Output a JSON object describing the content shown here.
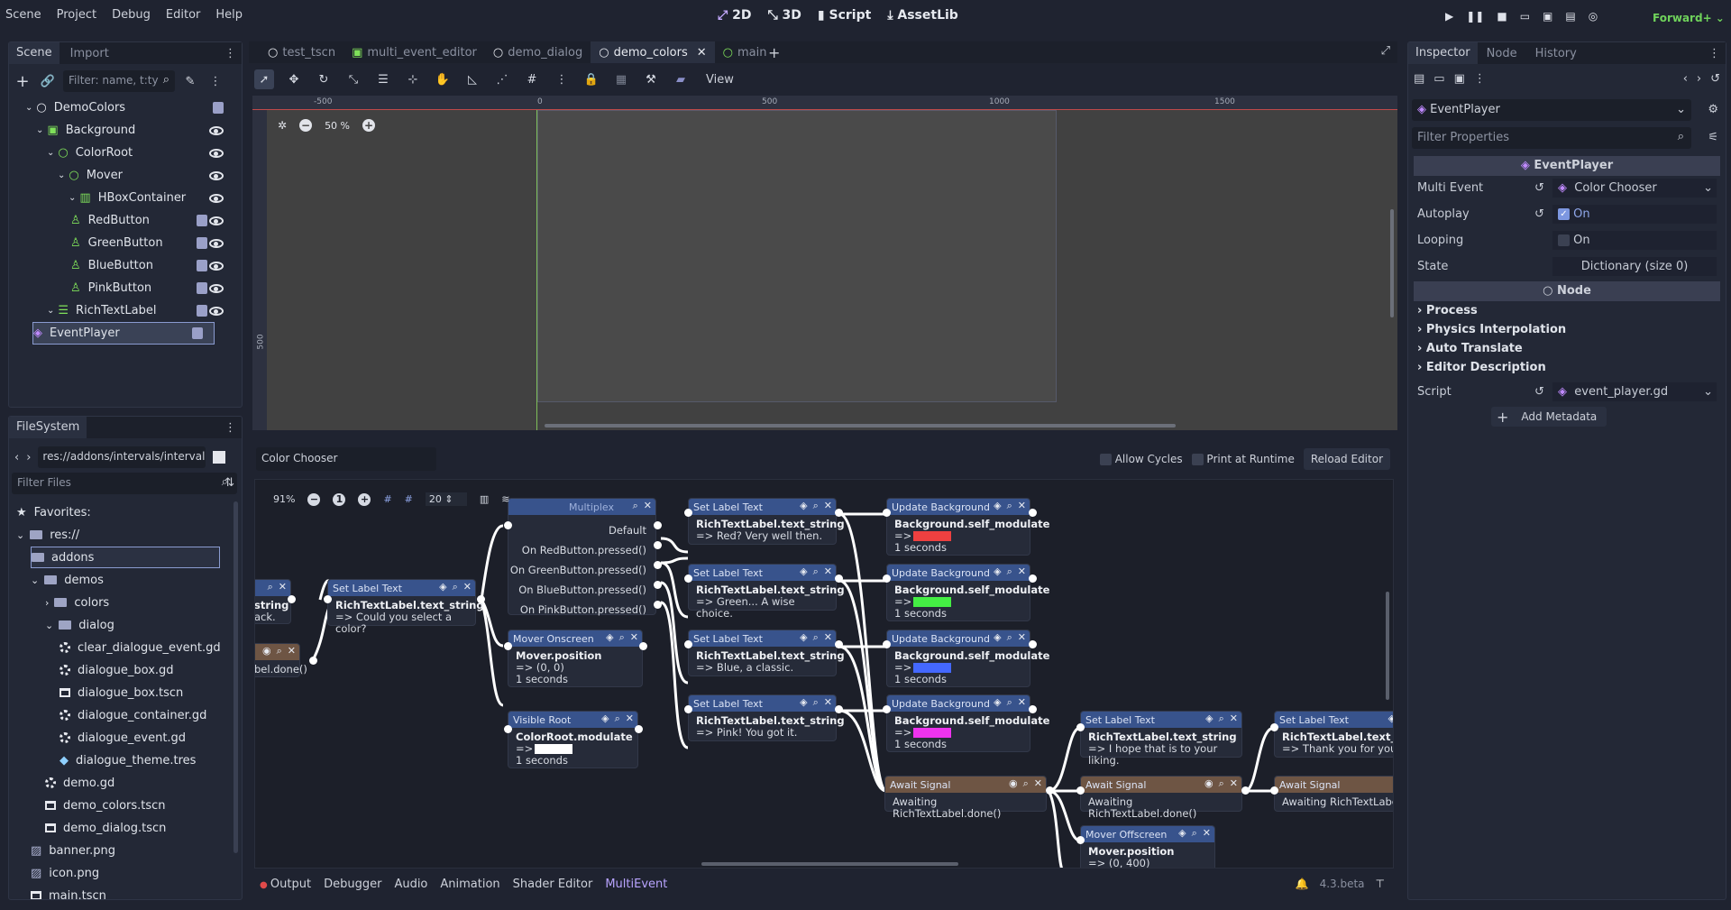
{
  "menu": [
    "Scene",
    "Project",
    "Debug",
    "Editor",
    "Help"
  ],
  "workspaces": [
    {
      "icon": "2d-icon",
      "label": "2D"
    },
    {
      "icon": "3d-icon",
      "label": "3D"
    },
    {
      "icon": "script-icon",
      "label": "Script"
    },
    {
      "icon": "assetlib-icon",
      "label": "AssetLib"
    }
  ],
  "renderer": "Forward+",
  "scene_panel": {
    "tabs": [
      "Scene",
      "Import"
    ],
    "filter_placeholder": "Filter: name, t:ty",
    "tree": [
      {
        "label": "DemoColors",
        "indent": 0
      },
      {
        "label": "Background",
        "indent": 1
      },
      {
        "label": "ColorRoot",
        "indent": 2
      },
      {
        "label": "Mover",
        "indent": 3
      },
      {
        "label": "HBoxContainer",
        "indent": 4
      },
      {
        "label": "RedButton",
        "indent": 5
      },
      {
        "label": "GreenButton",
        "indent": 5
      },
      {
        "label": "BlueButton",
        "indent": 5
      },
      {
        "label": "PinkButton",
        "indent": 5
      },
      {
        "label": "RichTextLabel",
        "indent": 2
      },
      {
        "label": "EventPlayer",
        "indent": 1
      }
    ]
  },
  "filesystem": {
    "tab": "FileSystem",
    "path": "res://addons/intervals/interval",
    "filter_placeholder": "Filter Files",
    "items": [
      {
        "label": "Favorites:",
        "indent": 0,
        "kind": "star"
      },
      {
        "label": "res://",
        "indent": 0,
        "kind": "folder"
      },
      {
        "label": "addons",
        "indent": 1,
        "kind": "folder"
      },
      {
        "label": "demos",
        "indent": 1,
        "kind": "folder"
      },
      {
        "label": "colors",
        "indent": 2,
        "kind": "folder"
      },
      {
        "label": "dialog",
        "indent": 2,
        "kind": "folder"
      },
      {
        "label": "clear_dialogue_event.gd",
        "indent": 3,
        "kind": "gear"
      },
      {
        "label": "dialogue_box.gd",
        "indent": 3,
        "kind": "gear"
      },
      {
        "label": "dialogue_box.tscn",
        "indent": 3,
        "kind": "clap"
      },
      {
        "label": "dialogue_container.gd",
        "indent": 3,
        "kind": "gear"
      },
      {
        "label": "dialogue_event.gd",
        "indent": 3,
        "kind": "gear"
      },
      {
        "label": "dialogue_theme.tres",
        "indent": 3,
        "kind": "theme"
      },
      {
        "label": "demo.gd",
        "indent": 2,
        "kind": "gear"
      },
      {
        "label": "demo_colors.tscn",
        "indent": 2,
        "kind": "clap"
      },
      {
        "label": "demo_dialog.tscn",
        "indent": 2,
        "kind": "clap"
      },
      {
        "label": "banner.png",
        "indent": 1,
        "kind": "img"
      },
      {
        "label": "icon.png",
        "indent": 1,
        "kind": "img"
      },
      {
        "label": "main.tscn",
        "indent": 1,
        "kind": "clap"
      }
    ]
  },
  "editor_tabs": [
    "test_tscn",
    "multi_event_editor",
    "demo_dialog",
    "demo_colors",
    "main"
  ],
  "toolbar": {
    "view_label": "View"
  },
  "viewport": {
    "zoom": "50 %",
    "ruler_labels": [
      "-500",
      "0",
      "500",
      "1000",
      "1500"
    ],
    "vruler_label": "500"
  },
  "multievent": {
    "name": "Color Chooser",
    "allow_cycles": "Allow Cycles",
    "print_runtime": "Print at Runtime",
    "reload": "Reload Editor",
    "zoom": "91%",
    "snap": "20"
  },
  "nodes": {
    "multiplex": {
      "title": "Multiplex",
      "rows": [
        "Default",
        "On RedButton.pressed()",
        "On GreenButton.pressed()",
        "On BlueButton.pressed()",
        "On PinkButton.pressed()"
      ]
    },
    "set_label_main": {
      "title": "Set Label Text",
      "prop": "RichTextLabel.text_string",
      "val": "=> Could you select a color?"
    },
    "left_node": {
      "prop": "string",
      "val": "ack."
    },
    "left_await": {
      "val": "bel.done()"
    },
    "mover_on": {
      "title": "Mover Onscreen",
      "prop": "Mover.position",
      "val": "=> (0, 0)",
      "dur": "1 seconds"
    },
    "visible_root": {
      "title": "Visible Root",
      "prop": "ColorRoot.modulate",
      "val": "=>",
      "dur": "1 seconds"
    },
    "labels": [
      {
        "title": "Set Label Text",
        "prop": "RichTextLabel.text_string",
        "val": "=> Red? Very well then."
      },
      {
        "title": "Set Label Text",
        "prop": "RichTextLabel.text_string",
        "val": "=> Green... A wise choice."
      },
      {
        "title": "Set Label Text",
        "prop": "RichTextLabel.text_string",
        "val": "=> Blue, a classic."
      },
      {
        "title": "Set Label Text",
        "prop": "RichTextLabel.text_string",
        "val": "=> Pink! You got it."
      }
    ],
    "backgrounds": [
      {
        "title": "Update Background",
        "prop": "Background.self_modulate",
        "val": "=>",
        "dur": "1 seconds",
        "color": "#ee4040"
      },
      {
        "title": "Update Background",
        "prop": "Background.self_modulate",
        "val": "=>",
        "dur": "1 seconds",
        "color": "#44ee44"
      },
      {
        "title": "Update Background",
        "prop": "Background.self_modulate",
        "val": "=>",
        "dur": "1 seconds",
        "color": "#4468ff"
      },
      {
        "title": "Update Background",
        "prop": "Background.self_modulate",
        "val": "=>",
        "dur": "1 seconds",
        "color": "#ee33ee"
      }
    ],
    "await1": {
      "title": "Await Signal",
      "val": "Awaiting RichTextLabel.done()"
    },
    "await2": {
      "title": "Await Signal",
      "val": "Awaiting RichTextLabel.done()"
    },
    "await3": {
      "title": "Await Signal",
      "val": "Awaiting RichTextLabe"
    },
    "label_hope": {
      "title": "Set Label Text",
      "prop": "RichTextLabel.text_string",
      "val": "=> I hope that is to your liking."
    },
    "label_thank": {
      "title": "Set Label Text",
      "prop": "RichTextLabel.text_st",
      "val": "=> Thank you for your"
    },
    "mover_off": {
      "title": "Mover Offscreen",
      "prop": "Mover.position",
      "val": "=> (0, 400)"
    }
  },
  "bottom_tabs": [
    "Output",
    "Debugger",
    "Audio",
    "Animation",
    "Shader Editor",
    "MultiEvent"
  ],
  "version": "4.3.beta",
  "inspector": {
    "tabs": [
      "Inspector",
      "Node",
      "History"
    ],
    "node": "EventPlayer",
    "filter_placeholder": "Filter Properties",
    "class_header": "EventPlayer",
    "rows": [
      {
        "label": "Multi Event",
        "value": "Color Chooser"
      },
      {
        "label": "Autoplay",
        "value": "On"
      },
      {
        "label": "Looping",
        "value": "On"
      },
      {
        "label": "State",
        "value": "Dictionary (size 0)"
      }
    ],
    "node_header": "Node",
    "sections": [
      "Process",
      "Physics Interpolation",
      "Auto Translate",
      "Editor Description"
    ],
    "script_label": "Script",
    "script_value": "event_player.gd",
    "add_metadata": "Add Metadata"
  }
}
